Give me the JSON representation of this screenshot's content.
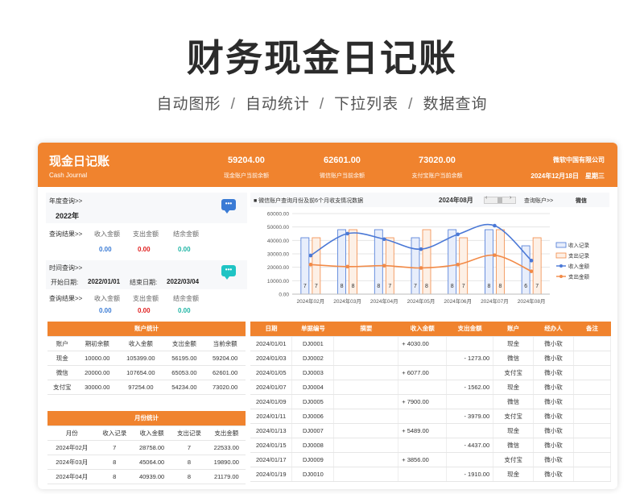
{
  "hero": {
    "title": "财务现金日记账",
    "features": [
      "自动图形",
      "自动统计",
      "下拉列表",
      "数据查询"
    ],
    "separator": "/"
  },
  "header": {
    "title": "现金日记账",
    "subtitle": "Cash Journal",
    "stats": [
      {
        "value": "59204.00",
        "label": "现金账户当前余额"
      },
      {
        "value": "62601.00",
        "label": "微信账户当前余额"
      },
      {
        "value": "73020.00",
        "label": "支付宝账户当前余额"
      }
    ],
    "company": "微软中国有限公司",
    "date": "2024年12月18日",
    "weekday": "星期三"
  },
  "year_query": {
    "label": "年度查询>>",
    "year": "2022年",
    "result_label": "查询结果>>",
    "captions": [
      "收入金额",
      "支出金额",
      "结余金额"
    ],
    "values": [
      "0.00",
      "0.00",
      "0.00"
    ]
  },
  "time_query": {
    "label": "时间查询>>",
    "start_label": "开始日期:",
    "start": "2022/01/01",
    "end_label": "结束日期:",
    "end": "2022/03/04",
    "result_label": "查询结果>>",
    "captions": [
      "收入金额",
      "支出金额",
      "结余金额"
    ],
    "values": [
      "0.00",
      "0.00",
      "0.00"
    ]
  },
  "icons": {
    "chat": "chat-bubble-icon",
    "prev": "chevron-left-icon",
    "next": "chevron-right-icon"
  },
  "colors": {
    "accent": "#f0832e",
    "income": "#4a78d6",
    "expense": "#f28a47",
    "blue_text": "#3a7bd5",
    "red_text": "#e02020",
    "green_text": "#1fb5a5"
  },
  "chart_header": {
    "title": "■ 微信账户查询月份及前6个月收支情况数据",
    "month": "2024年08月",
    "prev": "‹",
    "next": "›",
    "account_label": "查询账户>>",
    "account": "微信"
  },
  "chart_data": {
    "type": "bar",
    "categories": [
      "2024年02月",
      "2024年03月",
      "2024年04月",
      "2024年05月",
      "2024年06月",
      "2024年07月",
      "2024年08月"
    ],
    "y_ticks": [
      "0.00",
      "10000.00",
      "20000.00",
      "30000.00",
      "40000.00",
      "50000.00",
      "60000.00"
    ],
    "ylim": [
      0,
      60000
    ],
    "grid": true,
    "legend_position": "right",
    "series": [
      {
        "name": "收入记录",
        "kind": "bar",
        "values": [
          42000,
          48000,
          48000,
          42000,
          48000,
          48000,
          36000
        ],
        "labels": [
          "7",
          "8",
          "8",
          "7",
          "8",
          "8",
          "6"
        ]
      },
      {
        "name": "支出记录",
        "kind": "bar",
        "values": [
          42000,
          48000,
          42000,
          48000,
          42000,
          48000,
          42000
        ],
        "labels": [
          "7",
          "8",
          "7",
          "8",
          "7",
          "8",
          "7"
        ]
      },
      {
        "name": "收入金额",
        "kind": "line",
        "values": [
          28758,
          45064,
          40939,
          33500,
          44500,
          51000,
          25000
        ]
      },
      {
        "name": "支出金额",
        "kind": "line",
        "values": [
          22000,
          20500,
          21200,
          19500,
          22000,
          29000,
          17000
        ]
      }
    ]
  },
  "account_stats": {
    "title": "账户统计",
    "columns": [
      "账户",
      "期初余额",
      "收入金额",
      "支出金额",
      "当前余额"
    ],
    "rows": [
      [
        "现金",
        "10000.00",
        "105399.00",
        "56195.00",
        "59204.00"
      ],
      [
        "微信",
        "20000.00",
        "107654.00",
        "65053.00",
        "62601.00"
      ],
      [
        "支付宝",
        "30000.00",
        "97254.00",
        "54234.00",
        "73020.00"
      ]
    ]
  },
  "month_stats": {
    "title": "月份统计",
    "columns": [
      "月份",
      "收入记录",
      "收入金额",
      "支出记录",
      "支出金额"
    ],
    "rows": [
      [
        "2024年02月",
        "7",
        "28758.00",
        "7",
        "22533.00"
      ],
      [
        "2024年03月",
        "8",
        "45064.00",
        "8",
        "19890.00"
      ],
      [
        "2024年04月",
        "8",
        "40939.00",
        "8",
        "21179.00"
      ]
    ]
  },
  "journal": {
    "columns": [
      "日期",
      "单据编号",
      "摘要",
      "收入金额",
      "支出金额",
      "账户",
      "经办人",
      "备注"
    ],
    "rows": [
      [
        "2024/01/01",
        "DJ0001",
        "",
        "+ 4030.00",
        "",
        "现金",
        "微小软",
        ""
      ],
      [
        "2024/01/03",
        "DJ0002",
        "",
        "",
        "- 1273.00",
        "微信",
        "微小软",
        ""
      ],
      [
        "2024/01/05",
        "DJ0003",
        "",
        "+ 6077.00",
        "",
        "支付宝",
        "微小软",
        ""
      ],
      [
        "2024/01/07",
        "DJ0004",
        "",
        "",
        "- 1562.00",
        "现金",
        "微小软",
        ""
      ],
      [
        "2024/01/09",
        "DJ0005",
        "",
        "+ 7900.00",
        "",
        "微信",
        "微小软",
        ""
      ],
      [
        "2024/01/11",
        "DJ0006",
        "",
        "",
        "- 3979.00",
        "支付宝",
        "微小软",
        ""
      ],
      [
        "2024/01/13",
        "DJ0007",
        "",
        "+ 5489.00",
        "",
        "现金",
        "微小软",
        ""
      ],
      [
        "2024/01/15",
        "DJ0008",
        "",
        "",
        "- 4437.00",
        "微信",
        "微小软",
        ""
      ],
      [
        "2024/01/17",
        "DJ0009",
        "",
        "+ 3856.00",
        "",
        "支付宝",
        "微小软",
        ""
      ],
      [
        "2024/01/19",
        "DJ0010",
        "",
        "",
        "- 1910.00",
        "现金",
        "微小软",
        ""
      ]
    ]
  }
}
